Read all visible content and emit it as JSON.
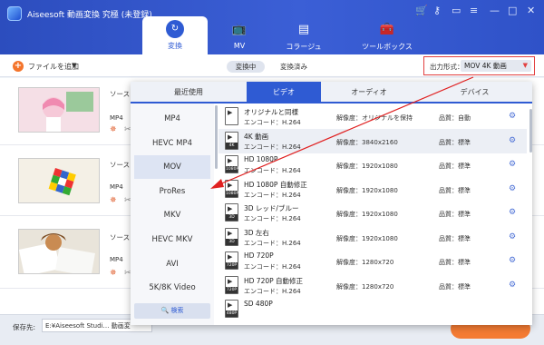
{
  "app": {
    "title": "Aiseesoft 動画変換 究極 (未登録)"
  },
  "window_controls": [
    {
      "name": "cart-icon",
      "glyph": "🛒"
    },
    {
      "name": "key-icon",
      "glyph": "⚷"
    },
    {
      "name": "chat-icon",
      "glyph": "▭"
    },
    {
      "name": "menu-icon",
      "glyph": "≡"
    },
    {
      "name": "minimize-icon",
      "glyph": "—"
    },
    {
      "name": "maximize-icon",
      "glyph": "□"
    },
    {
      "name": "close-icon",
      "glyph": "✕"
    }
  ],
  "main_tabs": [
    {
      "label": "変換",
      "icon": "convert-icon",
      "glyph": "↻"
    },
    {
      "label": "MV",
      "icon": "tv-icon",
      "glyph": "📺"
    },
    {
      "label": "コラージュ",
      "icon": "collage-icon",
      "glyph": "▤"
    },
    {
      "label": "ツールボックス",
      "icon": "toolbox-icon",
      "glyph": "🧰"
    }
  ],
  "toolbar": {
    "add_label": "ファイルを追加",
    "segments": [
      "変換中",
      "変換済み"
    ],
    "format_label": "出力形式：",
    "format_value": "MOV 4K 動画"
  },
  "files": [
    {
      "source": "ソース:",
      "format": "MP4",
      "thumb": "anime"
    },
    {
      "source": "ソース:",
      "format": "MP4",
      "thumb": "cube"
    },
    {
      "source": "ソース:",
      "format": "MP4",
      "thumb": "drawing"
    }
  ],
  "bottom": {
    "save_label": "保存先:",
    "save_path": "E:¥Aiseesoft Studi…  動画変"
  },
  "popup": {
    "tabs": [
      "最近使用",
      "ビデオ",
      "オーディオ",
      "デバイス"
    ],
    "active_tab": 1,
    "categories": [
      "MP4",
      "HEVC MP4",
      "MOV",
      "ProRes",
      "MKV",
      "HEVC MKV",
      "AVI",
      "5K/8K Video"
    ],
    "active_category": 2,
    "search_label": "検索",
    "options": [
      {
        "name": "オリジナルと同様",
        "encoder": "エンコード：H.264",
        "resolution": "解像度：オリジナルを保持",
        "quality": "品質：自動",
        "badge": ""
      },
      {
        "name": "4K 動画",
        "encoder": "エンコード：H.264",
        "resolution": "解像度：3840x2160",
        "quality": "品質：標準",
        "badge": "4K"
      },
      {
        "name": "HD 1080P",
        "encoder": "エンコード：H.264",
        "resolution": "解像度：1920x1080",
        "quality": "品質：標準",
        "badge": "1080P"
      },
      {
        "name": "HD 1080P 自動修正",
        "encoder": "エンコード：H.264",
        "resolution": "解像度：1920x1080",
        "quality": "品質：標準",
        "badge": "1080P"
      },
      {
        "name": "3D レッド/ブルー",
        "encoder": "エンコード：H.264",
        "resolution": "解像度：1920x1080",
        "quality": "品質：標準",
        "badge": "3D"
      },
      {
        "name": "3D 左右",
        "encoder": "エンコード：H.264",
        "resolution": "解像度：1920x1080",
        "quality": "品質：標準",
        "badge": "3D"
      },
      {
        "name": "HD 720P",
        "encoder": "エンコード：H.264",
        "resolution": "解像度：1280x720",
        "quality": "品質：標準",
        "badge": "720P"
      },
      {
        "name": "HD 720P 自動修正",
        "encoder": "エンコード：H.264",
        "resolution": "解像度：1280x720",
        "quality": "品質：標準",
        "badge": "720P"
      },
      {
        "name": "SD 480P",
        "encoder": "",
        "resolution": "",
        "quality": "",
        "badge": "480P"
      }
    ],
    "active_option": 1
  },
  "colors": {
    "accent": "#2f5bd3",
    "header": "#3354c9",
    "highlight": "#e24040",
    "orange": "#f47b33"
  }
}
